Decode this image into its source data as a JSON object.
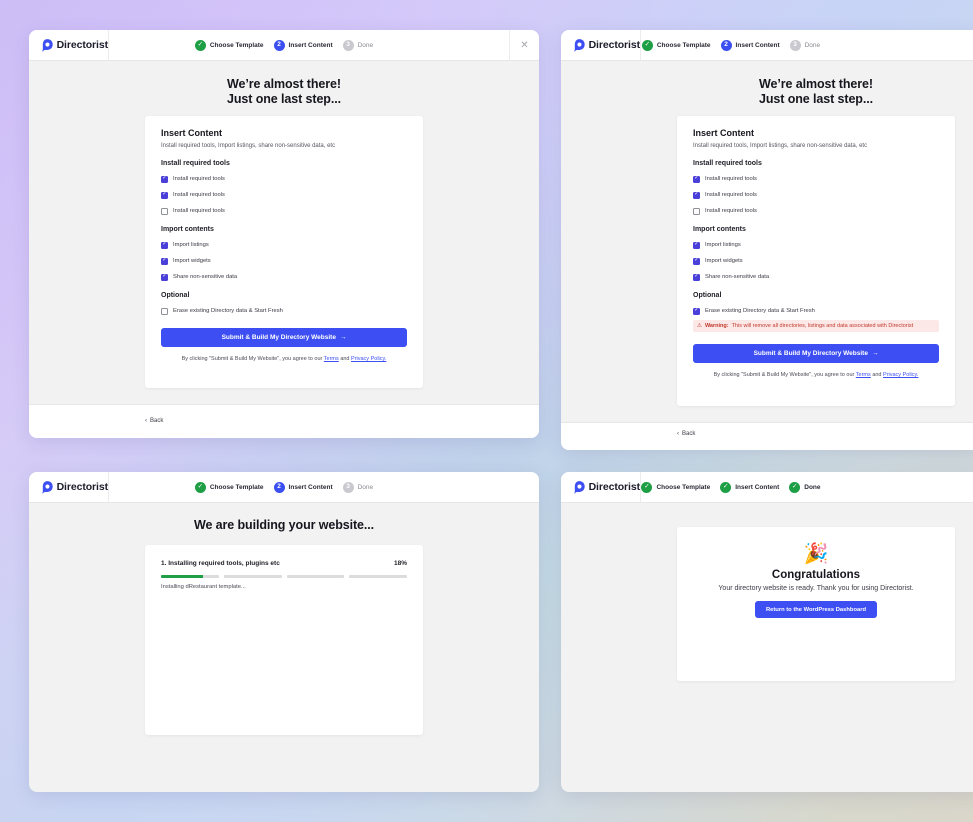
{
  "brand": {
    "name": "Directorist",
    "color": "#3d4ff2"
  },
  "colors": {
    "done": "#1e9e45",
    "active": "#3b4ff0",
    "pending": "#c9c9cf",
    "checkbox": "#4a3fd8",
    "warning_bg": "#fde8e8",
    "warning_text": "#c0392b"
  },
  "steps": {
    "step1": {
      "label": "Choose Template"
    },
    "step2": {
      "label": "Insert Content",
      "number": "2"
    },
    "step3": {
      "label": "Done",
      "number": "3"
    }
  },
  "insert": {
    "heading_line1": "We’re almost there!",
    "heading_line2": "Just one last step...",
    "card_title": "Insert Content",
    "card_subtitle": "Install required tools, Import listings, share non-sensitive data, etc",
    "section_tools": "Install required tools",
    "tools": [
      "Install required tools",
      "Install required tools",
      "Install required tools"
    ],
    "section_import": "Import contents",
    "imports": [
      "Import listings",
      "Import widgets",
      "Share non-sensitive data"
    ],
    "section_optional": "Optional",
    "optional_item": "Erase existing Directory data & Start Fresh",
    "warning_label": "Warning:",
    "warning_text": "This will remove all directories, listings and data associated with Directorist",
    "submit_label": "Submit & Build My Directory Website",
    "agree_prefix": "By clicking \"Submit & Build My Website\", you agree to our",
    "terms_label": "Terms",
    "and_label": "and",
    "privacy_label": "Privacy Policy.",
    "back_label": "Back"
  },
  "building": {
    "heading": "We are building your website...",
    "task_label": "1. Installing required tools, plugins etc",
    "percent_text": "18%",
    "progress": 0.18,
    "status": "Installing dRestaurant template..."
  },
  "done": {
    "emoji": "🎉",
    "title": "Congratulations",
    "subtitle": "Your directory website is ready. Thank you for using Directorist.",
    "button_label": "Return to the WordPress Dashboard"
  }
}
